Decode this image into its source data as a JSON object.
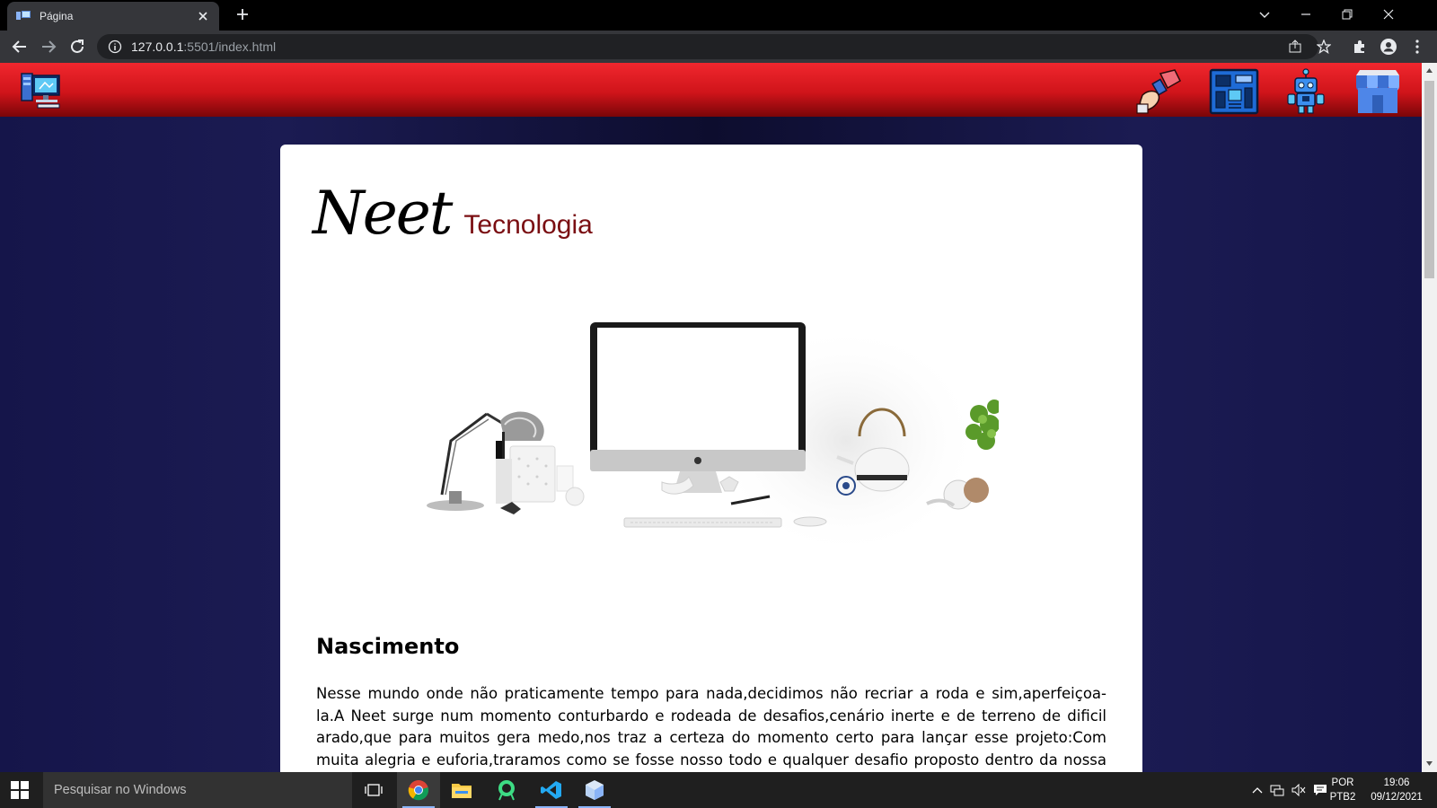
{
  "browser": {
    "tab_title": "Página",
    "url_host": "127.0.0.1",
    "url_path": ":5501/index.html"
  },
  "site": {
    "brand_script": "Neet",
    "brand_sub": "Tecnologia",
    "section_title": "Nascimento",
    "section_body": "Nesse mundo onde não praticamente tempo para nada,decidimos não recriar a roda e sim,aperfeiçoa-la.A Neet surge num momento conturbardo e rodeada de desafios,cenário inerte e de terreno de dificil arado,que para muitos gera medo,nos traz a certeza do momento certo para lançar esse projeto:Com muita alegria e euforia,traramos como se fosse nosso todo e qualquer desafio proposto dentro da nossa área de"
  },
  "taskbar": {
    "search_placeholder": "Pesquisar no Windows",
    "lang_line1": "POR",
    "lang_line2": "PTB2",
    "time": "19:06",
    "date": "09/12/2021"
  },
  "colors": {
    "header_red": "#f0272e",
    "page_navy": "#15154a",
    "brand_sub_color": "#7a0e12"
  }
}
